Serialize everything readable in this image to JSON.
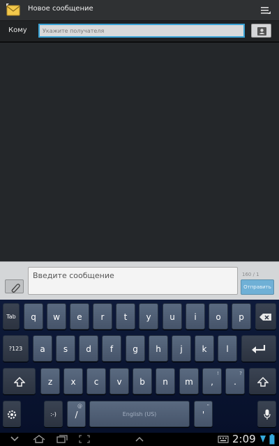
{
  "action_bar": {
    "title": "Новое сообщение"
  },
  "to_row": {
    "label": "Кому",
    "placeholder": "Укажите получателя"
  },
  "compose": {
    "placeholder": "Введите сообщение",
    "counter": "160 / 1",
    "send_label": "Отправить"
  },
  "keyboard": {
    "row1": [
      "Tab",
      "q",
      "w",
      "e",
      "r",
      "t",
      "y",
      "u",
      "i",
      "o",
      "p"
    ],
    "row2": [
      "?123",
      "a",
      "s",
      "d",
      "f",
      "g",
      "h",
      "j",
      "k",
      "l"
    ],
    "row3": [
      "z",
      "x",
      "c",
      "v",
      "b",
      "n",
      "m"
    ],
    "row3_punct": [
      ",",
      "."
    ],
    "row3_punct_alt": [
      "!",
      "?"
    ],
    "row4": {
      "emoticon": ":-)",
      "slash": "/",
      "slash_alt": "@",
      "space": "English (US)",
      "quote": "'",
      "quote_alt": "\""
    }
  },
  "status": {
    "time": "2:09"
  },
  "colors": {
    "accent": "#3aa3d6",
    "send": "#6fb0d6"
  }
}
